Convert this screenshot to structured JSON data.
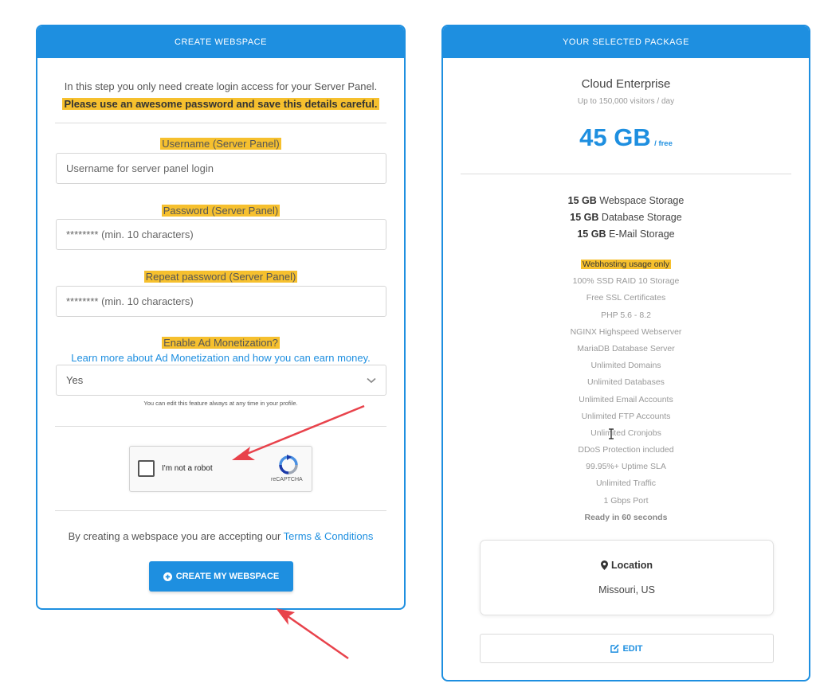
{
  "left_card": {
    "header": "CREATE WEBSPACE",
    "intro_line": "In this step you only need create login access for your Server Panel.",
    "intro_highlight": "Please use an awesome password and save this details careful.",
    "username": {
      "label": "Username (Server Panel)",
      "placeholder": "Username for server panel login"
    },
    "password": {
      "label": "Password (Server Panel)",
      "placeholder": "******** (min. 10 characters)"
    },
    "repeat_password": {
      "label": "Repeat password (Server Panel)",
      "placeholder": "******** (min. 10 characters)"
    },
    "monetization": {
      "label": "Enable Ad Monetization?",
      "link": "Learn more about Ad Monetization and how you can earn money.",
      "selected": "Yes",
      "note": "You can edit this feature always at any time in your profile."
    },
    "captcha": {
      "label": "I'm not a robot",
      "brand": "reCAPTCHA"
    },
    "terms_text": "By creating a webspace you are accepting our ",
    "terms_link": "Terms & Conditions",
    "create_button": "CREATE MY WEBSPACE"
  },
  "right_card": {
    "header": "YOUR SELECTED PACKAGE",
    "package_name": "Cloud Enterprise",
    "package_sub": "Up to 150,000 visitors / day",
    "size": "45 GB",
    "size_suffix": "/ free",
    "storage": [
      {
        "amount": "15 GB",
        "label": " Webspace Storage"
      },
      {
        "amount": "15 GB",
        "label": " Database Storage"
      },
      {
        "amount": "15 GB",
        "label": " E-Mail Storage"
      }
    ],
    "features": [
      "Webhosting usage only",
      "100% SSD RAID 10 Storage",
      "Free SSL Certificates",
      "PHP 5.6 - 8.2",
      "NGINX Highspeed Webserver",
      "MariaDB Database Server",
      "Unlimited Domains",
      "Unlimited Databases",
      "Unlimited Email Accounts",
      "Unlimited FTP Accounts",
      "Unlimited Cronjobs",
      "DDoS Protection included",
      "99.95%+ Uptime SLA",
      "Unlimited Traffic",
      "1 Gbps Port",
      "Ready in 60 seconds"
    ],
    "location_title": "Location",
    "location_value": "Missouri, US",
    "edit_button": "EDIT"
  },
  "colors": {
    "accent": "#1e8fe0",
    "highlight": "#f6c02e",
    "arrow": "#e8424b"
  },
  "icons": [
    "chevron-down-icon",
    "plus-circle-icon",
    "map-pin-icon",
    "edit-icon",
    "recaptcha-icon",
    "text-cursor-icon"
  ]
}
